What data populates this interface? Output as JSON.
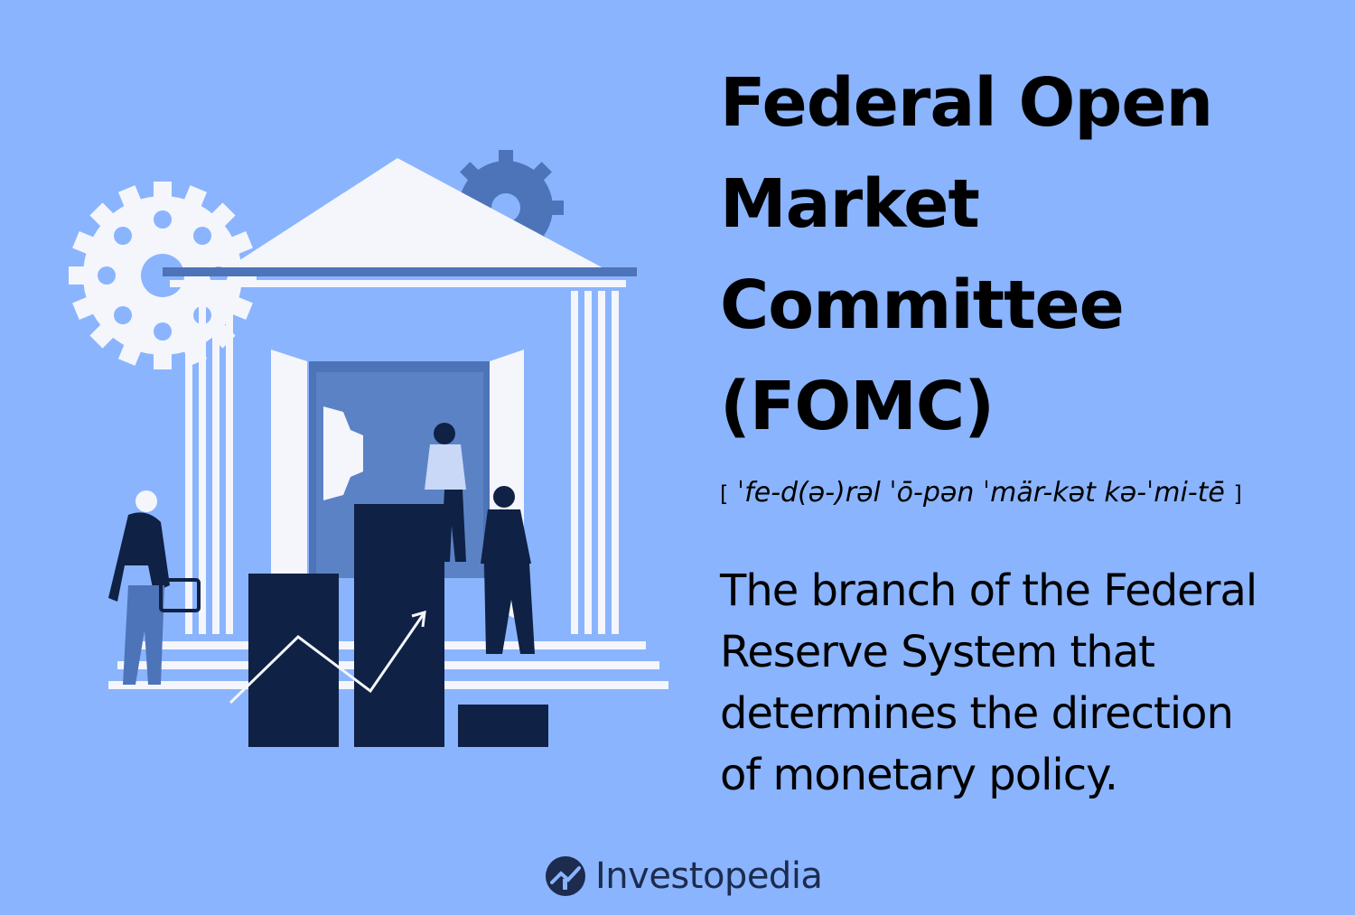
{
  "heading": {
    "title_lines": [
      "Federal Open",
      "Market",
      "Committee",
      "(FOMC)"
    ]
  },
  "pronunciation": {
    "open_bracket": "[",
    "text": "ˈfe-d(ə-)rəl ˈō-pən ˈmär-kət kə-ˈmi-tē",
    "close_bracket": "]"
  },
  "definition": {
    "lines": [
      "The branch of the Federal",
      "Reserve System that",
      "determines the direction",
      "of monetary policy."
    ]
  },
  "brand": {
    "name": "Investopedia",
    "logo_icon": "investopedia-logo-icon"
  },
  "illustration": {
    "elements": [
      "gear-icon",
      "gear-icon",
      "building-icon",
      "bar-chart-icon",
      "trend-arrow-icon",
      "person-icon",
      "person-icon",
      "person-icon"
    ]
  },
  "colors": {
    "background": "#8ab4fd",
    "navy": "#0f2144",
    "building_white": "#f4f6fc",
    "building_shadow": "#4d73b9",
    "text": "#000000",
    "brand": "#1c2b4e"
  }
}
